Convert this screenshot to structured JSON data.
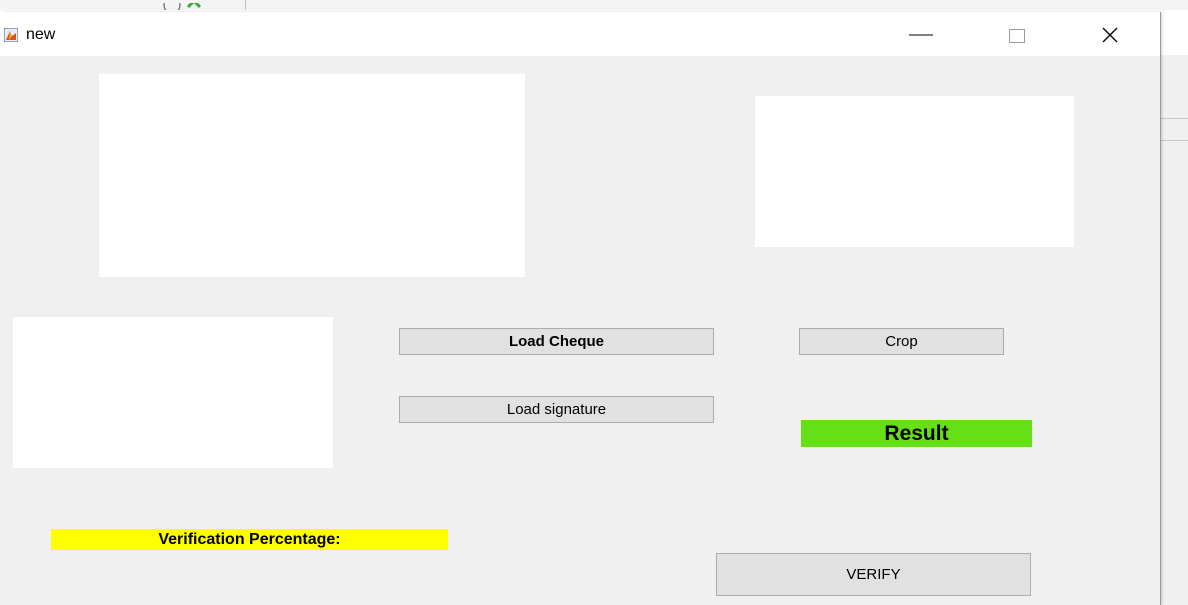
{
  "window": {
    "title": "new",
    "icon": "matlab-figure-icon"
  },
  "controls": {
    "minimize_icon": "minimize-icon",
    "maximize_icon": "maximize-icon",
    "close_icon": "close-icon"
  },
  "buttons": {
    "load_cheque": "Load Cheque",
    "crop": "Crop",
    "load_signature": "Load signature",
    "verify": "VERIFY"
  },
  "labels": {
    "result": "Result",
    "verification_percentage": "Verification Percentage:"
  },
  "colors": {
    "result_bg": "#66e016",
    "verification_bg": "#ffff00",
    "window_bg": "#f0f0f0"
  }
}
